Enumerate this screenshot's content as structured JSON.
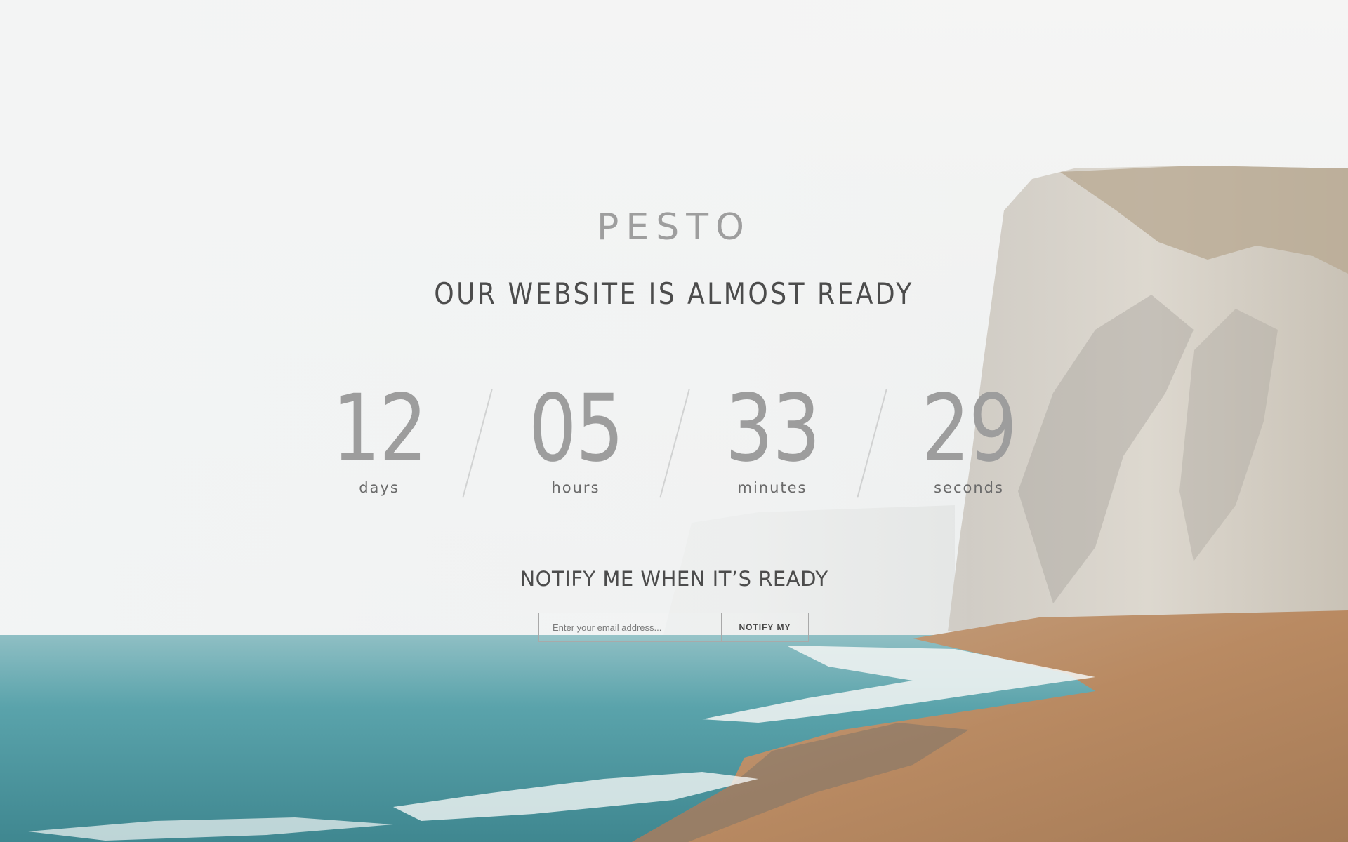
{
  "brand": {
    "logo": "PESTO"
  },
  "hero": {
    "headline": "OUR WEBSITE IS ALMOST READY"
  },
  "countdown": [
    {
      "value": "12",
      "label": "days"
    },
    {
      "value": "05",
      "label": "hours"
    },
    {
      "value": "33",
      "label": "minutes"
    },
    {
      "value": "29",
      "label": "seconds"
    }
  ],
  "notify": {
    "title": "NOTIFY ME WHEN IT’S READY",
    "email_placeholder": "Enter your email address...",
    "button_label": "NOTIFY MY"
  },
  "colors": {
    "counter_number": "#9d9d9d",
    "headline": "#4c4c4c",
    "sea": "#5aa3ab",
    "cliff": "#d9d4cc",
    "beach": "#b98a62"
  }
}
